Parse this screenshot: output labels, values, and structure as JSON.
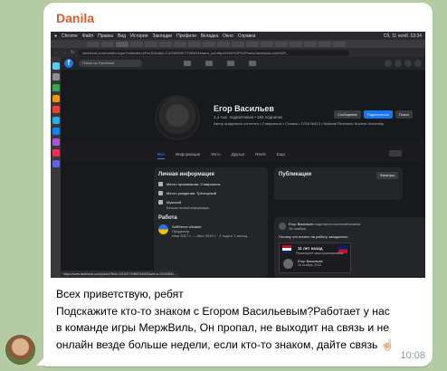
{
  "message": {
    "sender": "Danila",
    "lines": [
      "Всех приветствую, ребят",
      "Подскажите кто-то знаком с Егором Васильевым?Работает у нас",
      "в команде игры МержВиль, Он пропал, не выходит на связь и не",
      "онлайн везде больше недели, если кто-то знаком, дайте связь"
    ],
    "emoji": "☝🏻",
    "time": "10:08",
    "colors": {
      "sender": "#e4572e",
      "bubble": "#ffffff",
      "background": "#b5cba3"
    }
  },
  "screenshot": {
    "menubar": {
      "items": [
        "Chrome",
        "Файл",
        "Правка",
        "Вид",
        "История",
        "Закладки",
        "Профили",
        "Вкладка",
        "Окно",
        "Справка"
      ],
      "clock": "Сб, 11 нояб. 13:34"
    },
    "address": "facebook.com/vasilev.egor?mibextid=kFxxJD&rdid=C47Dt9S0ET7WNG&share_url=https%3A%2F%2Fwww.facebook.com%2F...",
    "facebook": {
      "search_placeholder": "Поиск на Facebook",
      "profile": {
        "name": "Егор Васильев",
        "friends": "1,4 тыс. подписчиков • 184 подписки",
        "meta": "Автор цифрового контента • Ставрополь • Сливка • СОШ №113 • National Research Nuclear University \"MEPhI\"",
        "buttons": [
          "Сообщение",
          "Подписаться",
          "Поиск"
        ]
      },
      "tabs": [
        "Все",
        "Информация",
        "Фото",
        "Друзья",
        "Reels",
        "Еще"
      ],
      "intro": {
        "title": "Личная информация",
        "rows": [
          {
            "text": "Место проживания: Ставрополь"
          },
          {
            "text": "Место рождения: Трёхгорный"
          },
          {
            "text": "Мужской"
          }
        ],
        "more": "Больше личной информации",
        "work_title": "Работа",
        "work_company": "SoftServe Ukraine",
        "work_role": "Продюсер",
        "work_dates": "Июн 2017 г. — Июл 2019 г. · 2 года и 1 месяц"
      },
      "posts": {
        "title": "Публикации",
        "filter": "Фильтры",
        "author": "Егор Васильев",
        "action": "поделился воспоминанием.",
        "date": "16 ноября",
        "text": "Потому что ничего на работу заходилось",
        "memory_years": "11 лет назад",
        "memory_sub": "Посмотрите свои воспоминания",
        "inner_author": "Егор Васильев",
        "inner_date": "16 ноября, 2012"
      }
    },
    "status_url": "https://www.facebook.com/photo/?fbid=10153774958744083&set=a.10152830..."
  }
}
